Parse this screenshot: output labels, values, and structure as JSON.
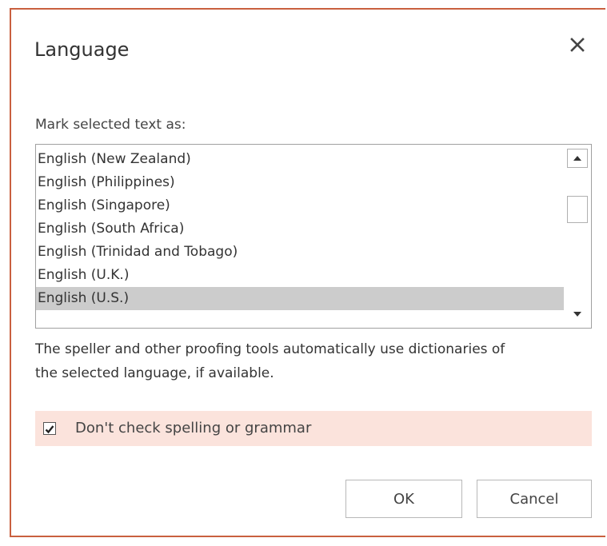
{
  "dialog": {
    "title": "Language",
    "prompt": "Mark selected text as:",
    "languages": [
      "English (New Zealand)",
      "English (Philippines)",
      "English (Singapore)",
      "English (South Africa)",
      "English (Trinidad and Tobago)",
      "English (U.K.)",
      "English (U.S.)"
    ],
    "selected_language": "English (U.S.)",
    "help_text": "The speller and other proofing tools automatically use dictionaries of the selected language, if available.",
    "checkbox_label": "Don't check spelling or grammar",
    "checkbox_checked": true,
    "ok_label": "OK",
    "cancel_label": "Cancel"
  },
  "icons": {
    "close": "close-icon",
    "scroll_up": "triangle-up-icon",
    "scroll_down": "triangle-down-icon",
    "check": "checkmark-icon"
  },
  "colors": {
    "dialog_border": "#c9603f",
    "selected_row": "#cccccc",
    "checkbox_row_bg": "#fbe3dc"
  }
}
